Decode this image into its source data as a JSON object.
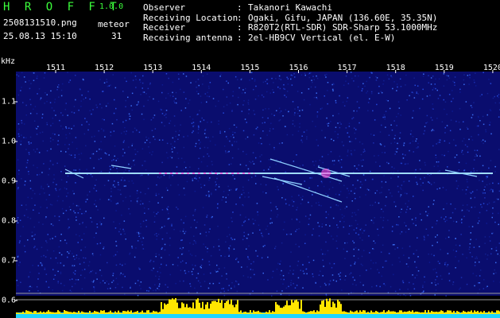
{
  "header": {
    "app_title": "H R O F F T",
    "app_version": "1.0.0",
    "filename": "2508131510.png",
    "datetime": "25.08.13 15:10",
    "meteor_label": "meteor",
    "meteor_count": "31",
    "info": [
      {
        "key": "Observer",
        "value": "Takanori Kawachi"
      },
      {
        "key": "Receiving Location",
        "value": "Ogaki, Gifu, JAPAN (136.60E, 35.35N)"
      },
      {
        "key": "Receiver",
        "value": "R820T2(RTL-SDR) SDR-Sharp 53.1000MHz"
      },
      {
        "key": "Receiving antenna",
        "value": "2el-HB9CV Vertical (el. E-W)"
      }
    ]
  },
  "spectrogram": {
    "unit_label": "kHz",
    "colors": {
      "background": "#0a0d6e",
      "signal": "#ffffff",
      "meteor": "#ff4fd8",
      "level_fill": "#ffe600",
      "level_base": "#1ed6ff"
    },
    "x_ticks": [
      "1511",
      "1512",
      "1513",
      "1514",
      "1515",
      "1516",
      "1517",
      "1518",
      "1519",
      "1520"
    ],
    "y_ticks": [
      "1.1",
      "1.0",
      "0.9",
      "0.8",
      "0.7",
      "0.6"
    ]
  },
  "chart_data": {
    "type": "heatmap",
    "xlabel": "",
    "ylabel": "kHz",
    "x_categories": [
      "1511",
      "1512",
      "1513",
      "1514",
      "1515",
      "1516",
      "1517",
      "1518",
      "1519",
      "1520"
    ],
    "y_ticks": [
      1.1,
      1.0,
      0.9,
      0.8,
      0.7,
      0.6
    ],
    "ylim": [
      0.6,
      1.15
    ],
    "carrier_khz": 0.92,
    "meteor_count": 31
  }
}
